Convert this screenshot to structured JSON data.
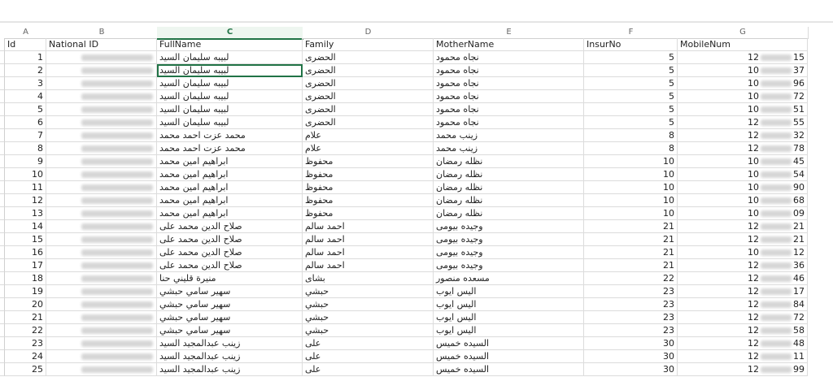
{
  "columns": [
    {
      "letter": "A",
      "header": "Id"
    },
    {
      "letter": "B",
      "header": "National ID"
    },
    {
      "letter": "C",
      "header": "FullName"
    },
    {
      "letter": "D",
      "header": "Family"
    },
    {
      "letter": "E",
      "header": "MotherName"
    },
    {
      "letter": "F",
      "header": "InsurNo"
    },
    {
      "letter": "G",
      "header": "MobileNum"
    }
  ],
  "selected_column": "C",
  "active_cell": "C3",
  "rows": [
    {
      "id": "1",
      "full": "لبيبه سليمان السيد",
      "family": "الحضرى",
      "mother": "نجاه محمود",
      "insur": "5",
      "mob_a": "12",
      "mob_b": "15"
    },
    {
      "id": "2",
      "full": "لبيبه سليمان السيد",
      "family": "الحضرى",
      "mother": "نجاه محمود",
      "insur": "5",
      "mob_a": "10",
      "mob_b": "37"
    },
    {
      "id": "3",
      "full": "لبيبه سليمان السيد",
      "family": "الحضرى",
      "mother": "نجاه محمود",
      "insur": "5",
      "mob_a": "10",
      "mob_b": "96"
    },
    {
      "id": "4",
      "full": "لبيبه سليمان السيد",
      "family": "الحضرى",
      "mother": "نجاه محمود",
      "insur": "5",
      "mob_a": "10",
      "mob_b": "72"
    },
    {
      "id": "5",
      "full": "لبيبه سليمان السيد",
      "family": "الحضرى",
      "mother": "نجاه محمود",
      "insur": "5",
      "mob_a": "10",
      "mob_b": "51"
    },
    {
      "id": "6",
      "full": "لبيبه سليمان السيد",
      "family": "الحضرى",
      "mother": "نجاه محمود",
      "insur": "5",
      "mob_a": "12",
      "mob_b": "55"
    },
    {
      "id": "7",
      "full": "محمد عزت احمد محمد",
      "family": "علام",
      "mother": "زينب محمد",
      "insur": "8",
      "mob_a": "12",
      "mob_b": "32"
    },
    {
      "id": "8",
      "full": "محمد عزت احمد محمد",
      "family": "علام",
      "mother": "زينب محمد",
      "insur": "8",
      "mob_a": "12",
      "mob_b": "78"
    },
    {
      "id": "9",
      "full": "ابراهيم امين محمد",
      "family": "محفوظ",
      "mother": "نظله رمضان",
      "insur": "10",
      "mob_a": "10",
      "mob_b": "45"
    },
    {
      "id": "10",
      "full": "ابراهيم امين محمد",
      "family": "محفوظ",
      "mother": "نظله رمضان",
      "insur": "10",
      "mob_a": "10",
      "mob_b": "54"
    },
    {
      "id": "11",
      "full": "ابراهيم امين محمد",
      "family": "محفوظ",
      "mother": "نظله رمضان",
      "insur": "10",
      "mob_a": "10",
      "mob_b": "90"
    },
    {
      "id": "12",
      "full": "ابراهيم امين محمد",
      "family": "محفوظ",
      "mother": "نظله رمضان",
      "insur": "10",
      "mob_a": "10",
      "mob_b": "68"
    },
    {
      "id": "13",
      "full": "ابراهيم امين محمد",
      "family": "محفوظ",
      "mother": "نظله رمضان",
      "insur": "10",
      "mob_a": "10",
      "mob_b": "09"
    },
    {
      "id": "14",
      "full": "صلاح الدين محمد على",
      "family": "احمد سالم",
      "mother": "وجيده بيومى",
      "insur": "21",
      "mob_a": "12",
      "mob_b": "21"
    },
    {
      "id": "15",
      "full": "صلاح الدين محمد على",
      "family": "احمد سالم",
      "mother": "وجيده بيومى",
      "insur": "21",
      "mob_a": "12",
      "mob_b": "21"
    },
    {
      "id": "16",
      "full": "صلاح الدين محمد على",
      "family": "احمد سالم",
      "mother": "وجيده بيومى",
      "insur": "21",
      "mob_a": "10",
      "mob_b": "12"
    },
    {
      "id": "17",
      "full": "صلاح الدين محمد على",
      "family": "احمد سالم",
      "mother": "وجيده بيومى",
      "insur": "21",
      "mob_a": "12",
      "mob_b": "36"
    },
    {
      "id": "18",
      "full": "منيرة قليني حنا",
      "family": "بشاى",
      "mother": "مسعده منصور",
      "insur": "22",
      "mob_a": "12",
      "mob_b": "46"
    },
    {
      "id": "19",
      "full": "سهير سامي حبشي",
      "family": "حبشي",
      "mother": "اليس ايوب",
      "insur": "23",
      "mob_a": "12",
      "mob_b": "17"
    },
    {
      "id": "20",
      "full": "سهير سامي حبشي",
      "family": "حبشي",
      "mother": "اليس ايوب",
      "insur": "23",
      "mob_a": "12",
      "mob_b": "84"
    },
    {
      "id": "21",
      "full": "سهير سامي حبشي",
      "family": "حبشي",
      "mother": "اليس ايوب",
      "insur": "23",
      "mob_a": "12",
      "mob_b": "72"
    },
    {
      "id": "22",
      "full": "سهير سامي حبشي",
      "family": "حبشي",
      "mother": "اليس ايوب",
      "insur": "23",
      "mob_a": "12",
      "mob_b": "58"
    },
    {
      "id": "23",
      "full": "زينب عبدالمجيد السيد",
      "family": "على",
      "mother": "السيده خميس",
      "insur": "30",
      "mob_a": "12",
      "mob_b": "48"
    },
    {
      "id": "24",
      "full": "زينب عبدالمجيد السيد",
      "family": "على",
      "mother": "السيده خميس",
      "insur": "30",
      "mob_a": "12",
      "mob_b": "11"
    },
    {
      "id": "25",
      "full": "زينب عبدالمجيد السيد",
      "family": "على",
      "mother": "السيده خميس",
      "insur": "30",
      "mob_a": "12",
      "mob_b": "99"
    }
  ]
}
